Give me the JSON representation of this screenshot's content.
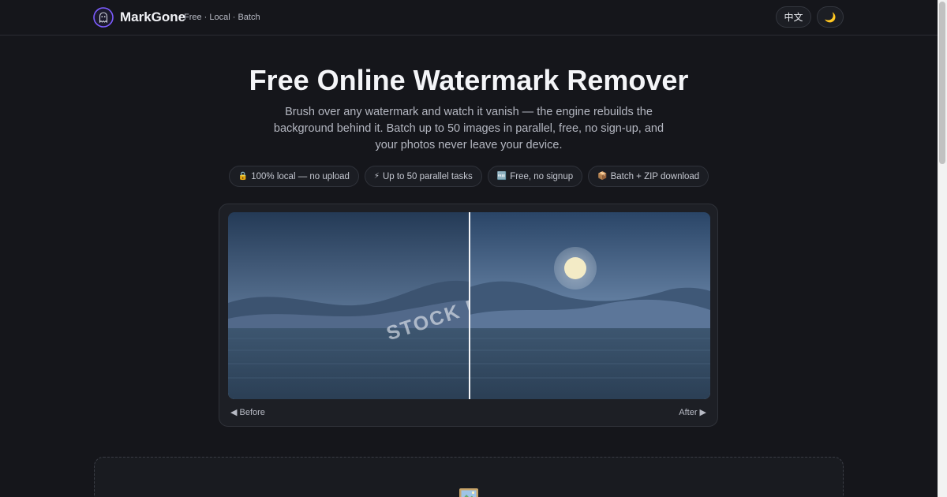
{
  "header": {
    "brand": "MarkGone",
    "tagline": "Free · Local · Batch",
    "logo_icon": "ghost-logo-icon",
    "lang_button": "中文",
    "theme_button": "🌙",
    "theme_icon": "moon-icon"
  },
  "hero": {
    "title": "Free Online Watermark Remover",
    "subtitle": "Brush over any watermark and watch it vanish — the engine rebuilds the background behind it. Batch up to 50 images in parallel, free, no sign-up, and your photos never leave your device."
  },
  "badges": [
    {
      "icon": "🔒",
      "icon_name": "lock-icon",
      "label": "100% local — no upload"
    },
    {
      "icon": "⚡",
      "icon_name": "lightning-icon",
      "label": "Up to 50 parallel tasks"
    },
    {
      "icon": "🆓",
      "icon_name": "free-icon",
      "label": "Free, no signup"
    },
    {
      "icon": "📦",
      "icon_name": "package-icon",
      "label": "Batch + ZIP download"
    }
  ],
  "compare": {
    "watermark_text": "STOCK PHO",
    "before_label": "◀ Before",
    "after_label": "After ▶",
    "divider_position": 0.5
  },
  "upload": {
    "icon": "🖼️",
    "icon_name": "image-frame-icon"
  },
  "colors": {
    "background": "#15161b",
    "card": "#1d1f25",
    "accent": "#7c5cff",
    "sky_top": "#1f3552",
    "sky_bottom": "#8fa7c4",
    "water": "#3a5068",
    "moon": "#f3ebc6"
  }
}
